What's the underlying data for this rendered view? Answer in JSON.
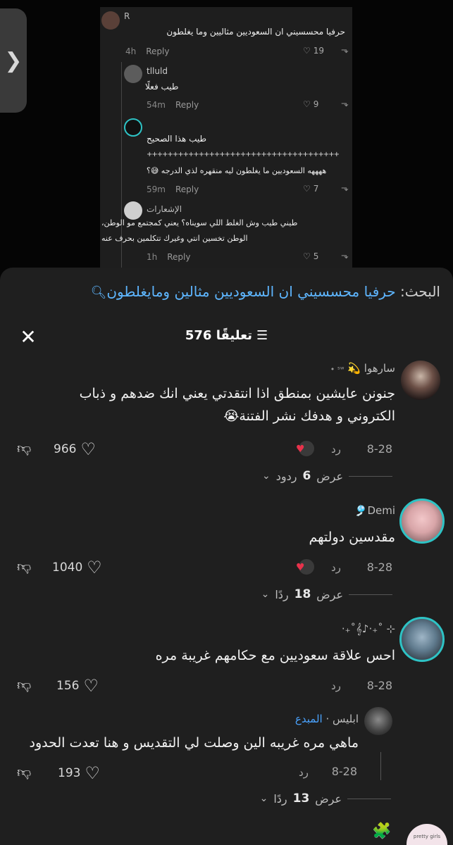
{
  "side_tab": {
    "glyph": "❯"
  },
  "embedded": {
    "comments": [
      {
        "name": "R",
        "text": "حرفيا محسسيني ان السعوديين مثاليين وما يغلطون",
        "time": "4h",
        "reply": "Reply",
        "likes": "19"
      },
      {
        "name": "tlluld",
        "text": "طيب فعلًا",
        "time": "54m",
        "reply": "Reply",
        "likes": "9"
      },
      {
        "name": "",
        "text": "طيب هذا الصحيح",
        "text2": "ههههه السعوديين ما يغلطون ليه منقهره لذي الدرجه 😅؟",
        "plus_row": "+++++++++++++++++++++++++++++++++++++",
        "time": "59m",
        "reply": "Reply",
        "likes": "7"
      },
      {
        "name": "الإشعارات",
        "text": "طيني طيب وش الغلط اللي سويناه؟ يعني كمجتمع مو الوطن،",
        "text2": "الوطن تخسين انتي وغيرك تتكلمين بحرف عنه",
        "time": "1h",
        "reply": "Reply",
        "likes": "5"
      }
    ]
  },
  "search": {
    "label": "البحث:",
    "query": "حرفيا محسسيني ان السعوديين مثالين ومايغلطون",
    "icon": "search-icon"
  },
  "header": {
    "count_label": "576 تعليقًا",
    "filter_icon": "☰",
    "close_icon": "✕"
  },
  "comments": [
    {
      "username": "سارهوا 💫",
      "suffix": "ˢʷ •",
      "lines": [
        "جنونن عايشين بمنطق اذا انتقدتي يعني انك ضدهم و ذباب",
        "الكتروني و هدفك نشر الفتنة😭"
      ],
      "date": "8-28",
      "reply": "رد",
      "likes": "966",
      "view_replies": "عرض",
      "replies_count": "6",
      "replies_word": "ردود"
    },
    {
      "username": "Demi🎐",
      "lines": [
        "مقدسين دولتهم"
      ],
      "date": "8-28",
      "reply": "رد",
      "likes": "1040",
      "view_replies": "عرض",
      "replies_count": "18",
      "replies_word": "ردًا"
    },
    {
      "username": "⊹ ˚₊‧♪𝄞˚₊‧",
      "lines": [
        "احس علاقة سعوديين مع حكامهم غريبة مره"
      ],
      "date": "8-28",
      "reply": "رد",
      "likes": "156"
    }
  ],
  "nested_reply": {
    "username": "ابليس",
    "dot": "·",
    "creator": "المبدع",
    "text": "ماهي مره غريبه الين وصلت لي التقديس و هنا تعدت الحدود",
    "date": "8-28",
    "reply": "رد",
    "likes": "193",
    "view_replies": "عرض",
    "replies_count": "13",
    "replies_word": "ردًا"
  },
  "bottom": {
    "puzzle": "🧩",
    "avatar_text": "pretty girls"
  }
}
